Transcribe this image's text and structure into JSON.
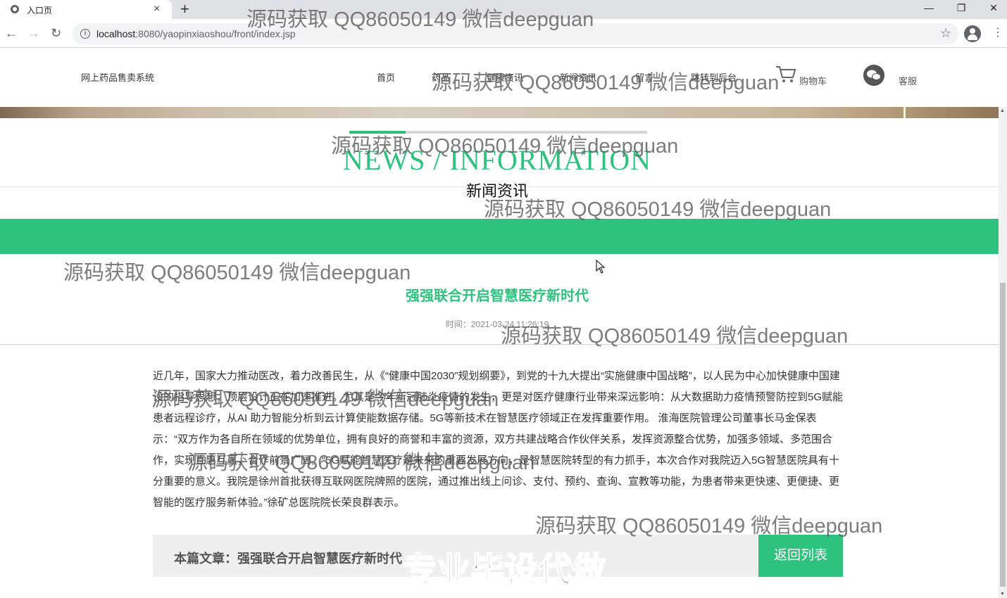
{
  "browser": {
    "tab_title": "入口页",
    "tab_close": "×",
    "new_tab": "+",
    "url_host": "localhost",
    "url_rest": ":8080/yaopinxiaoshou/front/index.jsp",
    "window_controls": [
      "—",
      "❐",
      "✕"
    ]
  },
  "site": {
    "logo_text": "网上药品售卖系统",
    "nav": [
      "首页",
      "药品",
      "健康资讯",
      "新闻资讯",
      "留言",
      "跳转到后台"
    ],
    "cart_label": "购物车",
    "service_label": "客服"
  },
  "section": {
    "title_en": "NEWS / INFORMATION",
    "title_cn": "新闻资讯"
  },
  "article": {
    "title": "强强联合开启智慧医疗新时代",
    "time": "时间：2021-03-24 11:26:19",
    "body": "近几年，国家大力推动医改，着力改善民生，从《“健康中国2030”规划纲要》，到党的十九大提出“实施健康中国战略”，以人民为中心加快健康中国建设的指导思想，顶层设计正在加速推进。尤其是今年新冠肺炎疫情的发生，更是对医疗健康行业带来深远影响：从大数据助力疫情预警防控到5G赋能患者远程诊疗，从AI 助力智能分析到云计算使能数据存储。5G等新技术在智慧医疗领域正在发挥重要作用。 淮海医院管理公司董事长马金保表示：“双方作为各自所在领域的优势单位，拥有良好的商誉和丰富的资源，双方共建战略合作伙伴关系，发挥资源整合优势，加强多领域、多范围合作，实现互惠互赢，合作前景广阔。“5G赋能智慧医疗是未来的重要发展方向，是智慧医院转型的有力抓手，本次合作对我院迈入5G智慧医院具有十分重要的意义。我院是徐州首批获得互联网医院牌照的医院，通过推出线上问诊、支付、预约、查询、宣教等功能，为患者带来更快速、更便捷、更智能的医疗服务新体验。”徐矿总医院院长荣良群表示。",
    "footer_prefix": "本篇文章：强强联合开启智慧医疗新时代",
    "back_button": "返回列表"
  },
  "watermarks": {
    "text": "源码获取 QQ86050149 微信deepguan",
    "big": "专业毕设代做"
  },
  "colors": {
    "accent": "#2ec27e"
  }
}
